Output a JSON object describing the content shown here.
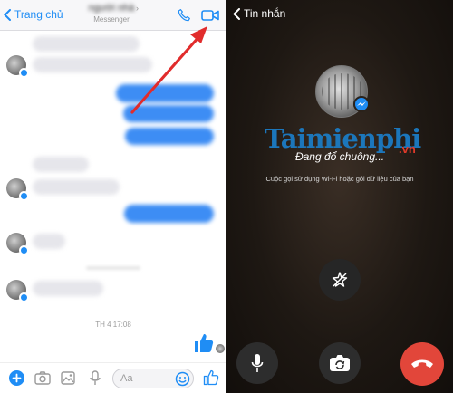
{
  "left": {
    "header": {
      "back_label": "Trang chủ",
      "contact_name": "người nhà",
      "contact_subtitle": "Messenger",
      "chevron": "›"
    },
    "timestamp": "TH 4 17:08",
    "composer": {
      "placeholder": "Aa"
    }
  },
  "right": {
    "back_label": "Tin nhắn",
    "watermark": {
      "brand": "Taimienphi",
      "tld": ".vn"
    },
    "status": "Đang đổ chuông...",
    "network_note": "Cuộc gọi sử dụng Wi-Fi hoặc gói dữ liệu của bạn"
  },
  "colors": {
    "messenger_blue": "#1f8df5",
    "outgoing_bubble": "#3d8df4",
    "incoming_bubble": "#e6e6eb",
    "end_call_red": "#e2463a",
    "arrow_red": "#e12c2c",
    "call_bg": "#18130f"
  },
  "icons": [
    "chevron-left-icon",
    "phone-icon",
    "video-camera-icon",
    "plus-icon",
    "camera-icon",
    "image-icon",
    "microphone-icon",
    "smiley-icon",
    "thumbs-up-icon",
    "messenger-bolt-icon",
    "sparkle-flip-icon",
    "camera-switch-icon",
    "end-call-icon"
  ]
}
